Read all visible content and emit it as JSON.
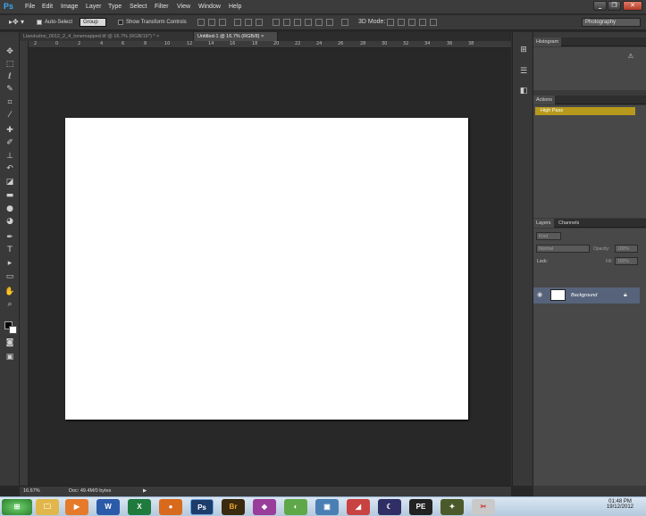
{
  "app": {
    "logo": "Ps"
  },
  "menu": [
    "File",
    "Edit",
    "Image",
    "Layer",
    "Type",
    "Select",
    "Filter",
    "View",
    "Window",
    "Help"
  ],
  "window_controls": {
    "minimize": "_",
    "restore": "❐",
    "close": "✕"
  },
  "options": {
    "auto_select_label": "Auto-Select",
    "auto_select_checked": true,
    "group_select": "Group",
    "show_transform_label": "Show Transform Controls",
    "show_transform_checked": false,
    "workspace": "Photography"
  },
  "tabs": [
    {
      "label": "Llandudno_0012_2_4_tonemapped.tif @ 16.7% (RGB/16*) *",
      "active": false,
      "close": "×"
    },
    {
      "label": "Untitled-1 @ 16.7% (RGB/8)",
      "active": true,
      "close": "×"
    }
  ],
  "ruler": {
    "top_ticks": [
      "2",
      "0",
      "2",
      "4",
      "6",
      "8",
      "10",
      "12",
      "14",
      "16",
      "18",
      "20",
      "22",
      "24",
      "26",
      "28",
      "30",
      "32",
      "34",
      "36",
      "38"
    ]
  },
  "status": {
    "zoom": "16.67%",
    "doc": "Doc: 49.4M/0 bytes"
  },
  "panels": {
    "histogram_tab": "Histogram",
    "actions_tab": "Actions",
    "action_item": "High Pass",
    "layers_tab": "Layers",
    "channels_tab": "Channels",
    "kind_filter": "Kind",
    "blend_mode": "Normal",
    "opacity_label": "Opacity:",
    "opacity_value": "100%",
    "lock_label": "Lock:",
    "fill_label": "Fill:",
    "fill_value": "100%",
    "layer_name": "Background"
  },
  "taskbar": {
    "time": "01:48 PM",
    "date": "19/12/2012"
  }
}
